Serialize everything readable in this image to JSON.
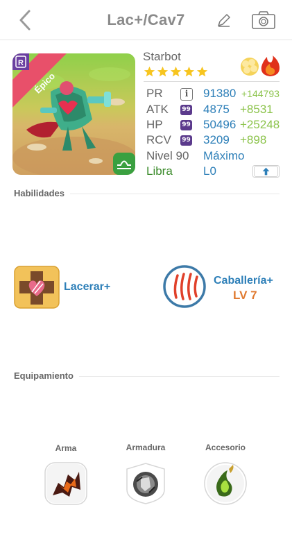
{
  "header": {
    "title": "Lac+/Cav7",
    "back_icon": "chevron-left-icon",
    "edit_icon": "pencil-icon",
    "camera_icon": "camera-icon"
  },
  "monster": {
    "name": "Starbot",
    "rarity": "Épico",
    "stars": 5,
    "elements": [
      "light-element-icon",
      "fire-element-icon"
    ],
    "badge_letter": "R",
    "sign_icon": "libra-icon"
  },
  "stats": [
    {
      "label": "PR",
      "badge": "i",
      "value": "91380",
      "bonus": "+144793"
    },
    {
      "label": "ATK",
      "badge": "99",
      "value": "4875",
      "bonus": "+8531"
    },
    {
      "label": "HP",
      "badge": "99",
      "value": "50496",
      "bonus": "+25248"
    },
    {
      "label": "RCV",
      "badge": "99",
      "value": "3209",
      "bonus": "+898"
    }
  ],
  "level": {
    "label": "Nivel 90",
    "value": "Máximo"
  },
  "sign": {
    "label": "Libra",
    "value": "L0"
  },
  "sections": {
    "skills": "Habilidades",
    "equipment": "Equipamiento"
  },
  "skills": [
    {
      "name": "Lacerar+",
      "icon": "lacerate-skill-icon"
    },
    {
      "name": "Caballería+",
      "level": "LV 7",
      "icon": "claw-marks-skill-icon"
    }
  ],
  "equipment": [
    {
      "label": "Arma",
      "icon": "weapon-icon"
    },
    {
      "label": "Armadura",
      "icon": "armor-icon"
    },
    {
      "label": "Accesorio",
      "icon": "accessory-icon"
    }
  ],
  "colors": {
    "accent_blue": "#2d7fb8",
    "bonus_green": "#8bc34a",
    "sign_green": "#3a8a2a",
    "level_orange": "#e07a30",
    "rarity_red": "#e8506a"
  }
}
